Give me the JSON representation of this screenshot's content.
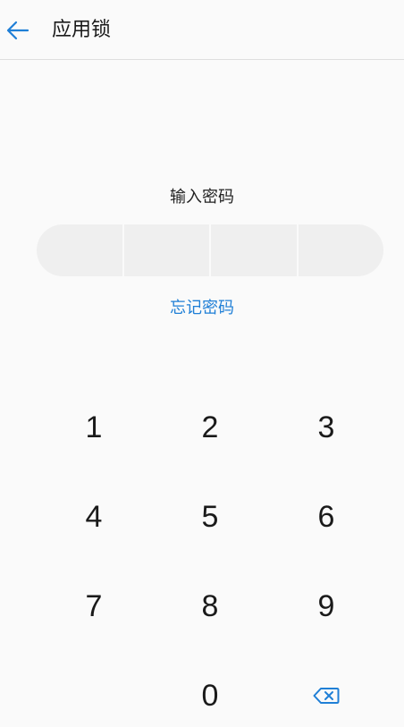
{
  "header": {
    "back_icon": "arrow-left-icon",
    "title": "应用锁"
  },
  "lock": {
    "prompt": "输入密码",
    "pin_length": 4,
    "forgot_label": "忘记密码"
  },
  "keypad": {
    "keys": [
      "1",
      "2",
      "3",
      "4",
      "5",
      "6",
      "7",
      "8",
      "9",
      "",
      "0"
    ],
    "delete_icon": "backspace-icon"
  },
  "colors": {
    "accent": "#1f7fd6",
    "background": "#fafafa",
    "field": "#efefef",
    "text": "#1a1a1a"
  }
}
